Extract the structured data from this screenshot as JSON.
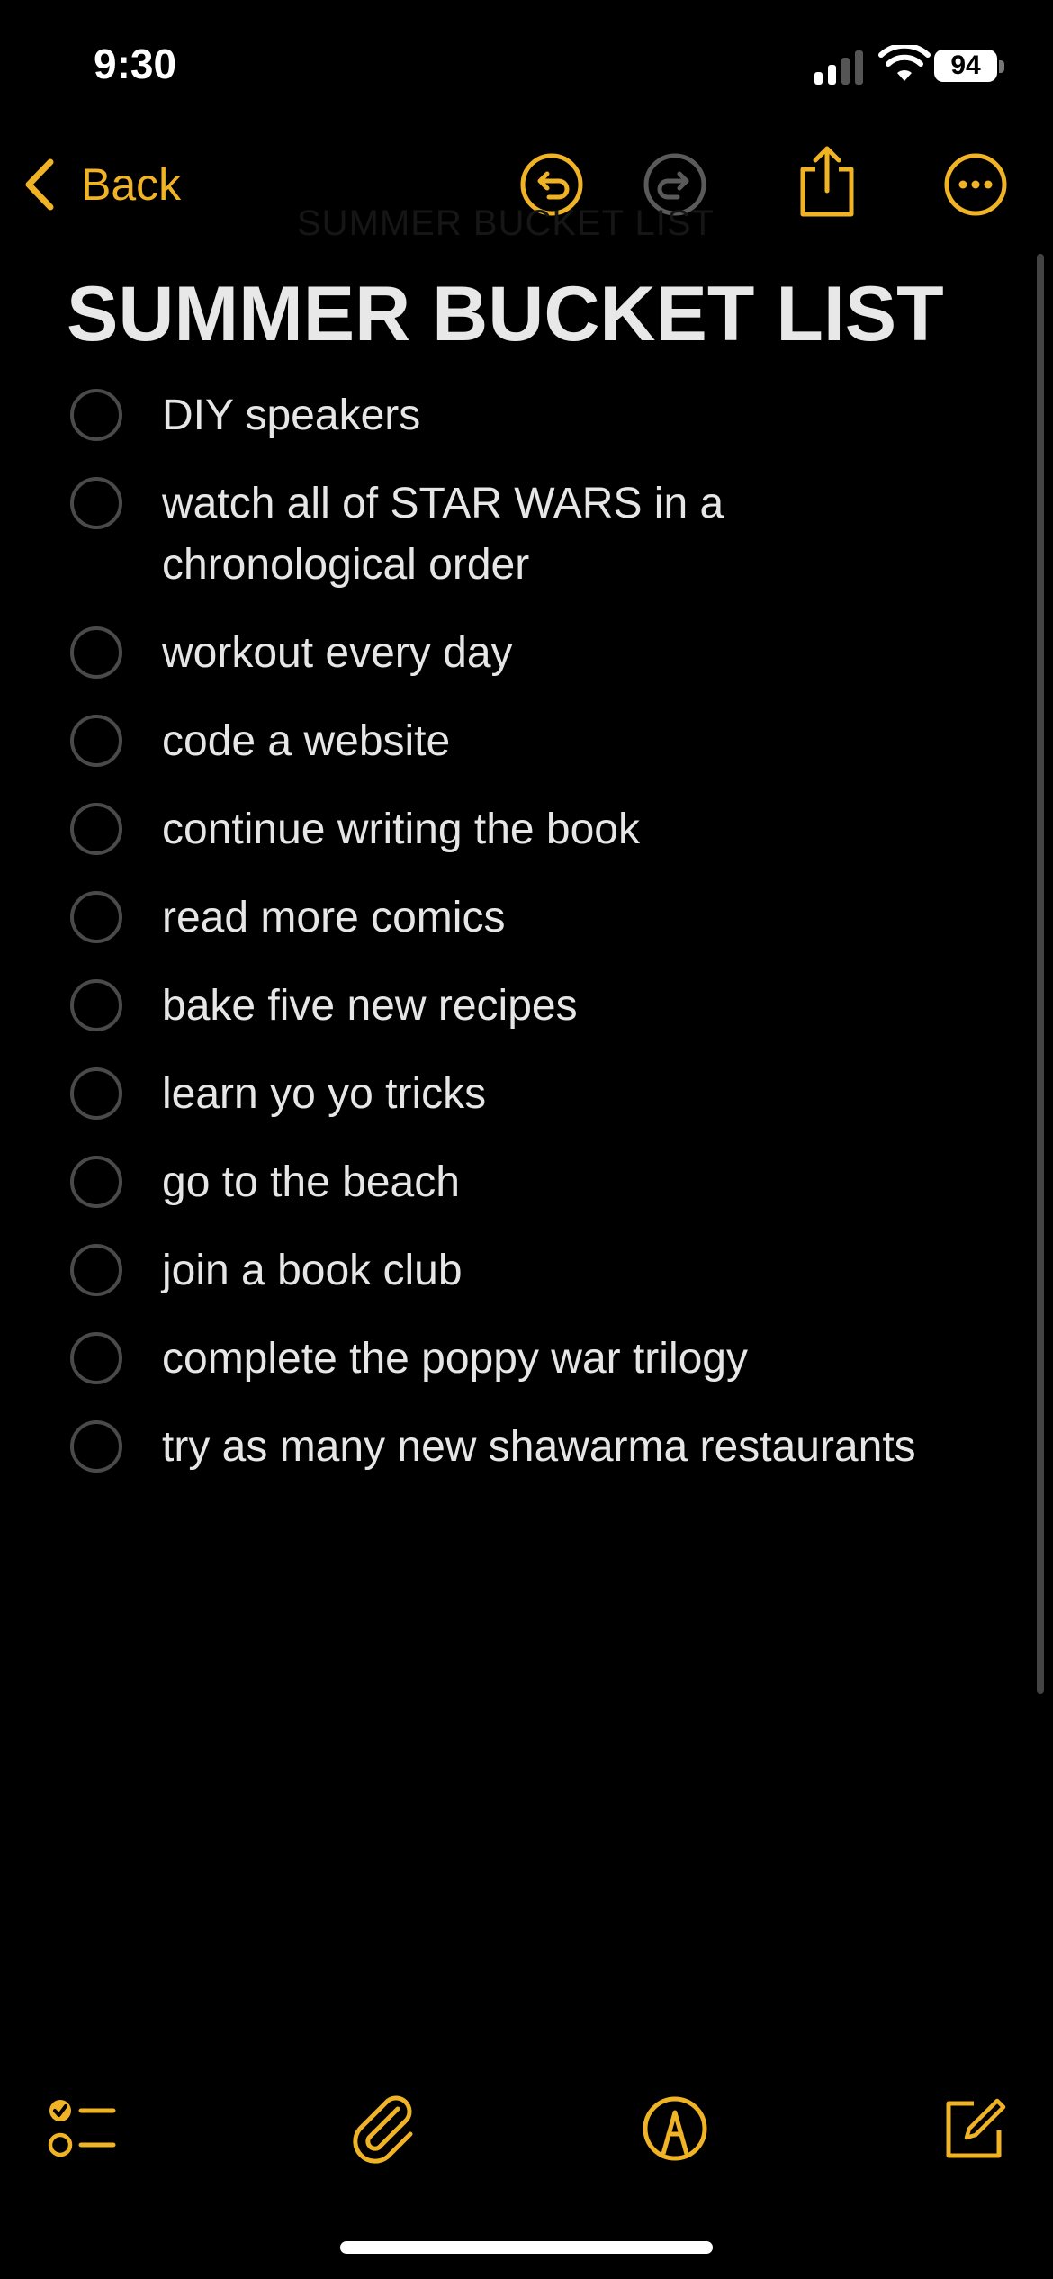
{
  "status_bar": {
    "time": "9:30",
    "battery": "94"
  },
  "toolbar": {
    "back_label": "Back"
  },
  "note": {
    "ghost_title": "SUMMER BUCKET LIST",
    "title": "SUMMER BUCKET LIST",
    "items": [
      "DIY speakers",
      "watch all of STAR WARS in a chronological order",
      "workout every day",
      "code a website",
      "continue writing the book",
      "read more comics",
      "bake five new recipes",
      "learn yo yo tricks",
      "go to the beach",
      "join a book club",
      "complete the poppy war trilogy",
      "try as many new shawarma restaurants"
    ]
  },
  "icons": {
    "back": "chevron-left-icon",
    "undo": "undo-icon",
    "redo": "redo-icon",
    "share": "share-icon",
    "more": "more-icon",
    "checklist": "checklist-icon",
    "attach": "paperclip-icon",
    "markup": "markup-pen-icon",
    "compose": "compose-icon"
  },
  "colors": {
    "accent": "#f0b325",
    "background": "#000000",
    "text": "#e6e6e6",
    "inactive": "#5a5a5a"
  }
}
